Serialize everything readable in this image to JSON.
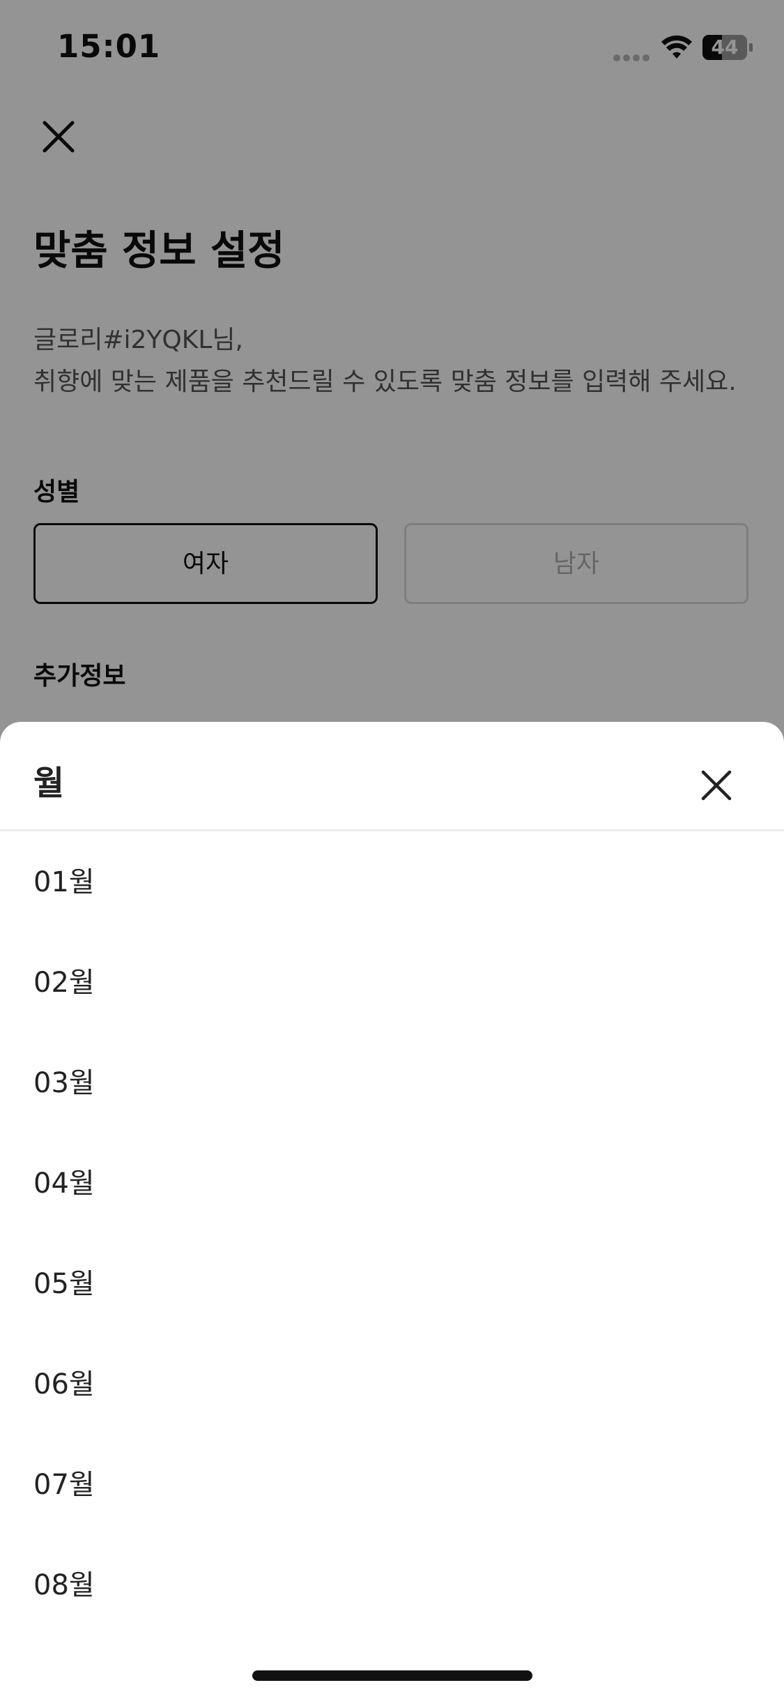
{
  "status_bar": {
    "time": "15:01",
    "battery": "44",
    "battery_level": 0.44
  },
  "page": {
    "title": "맞춤 정보 설정",
    "greeting_line1": "글로리#i2YQKL님,",
    "greeting_line2": "취향에 맞는 제품을 추천드릴 수 있도록 맞춤 정보를 입력해 주세요.",
    "gender_label": "성별",
    "gender_options": [
      "여자",
      "남자"
    ],
    "gender_selected": "여자",
    "additional_info_label": "추가정보"
  },
  "sheet": {
    "title": "월",
    "months": [
      "01월",
      "02월",
      "03월",
      "04월",
      "05월",
      "06월",
      "07월",
      "08월"
    ]
  },
  "colors": {
    "overlay": "#000000",
    "text": "#222222",
    "divider": "#ececec"
  }
}
